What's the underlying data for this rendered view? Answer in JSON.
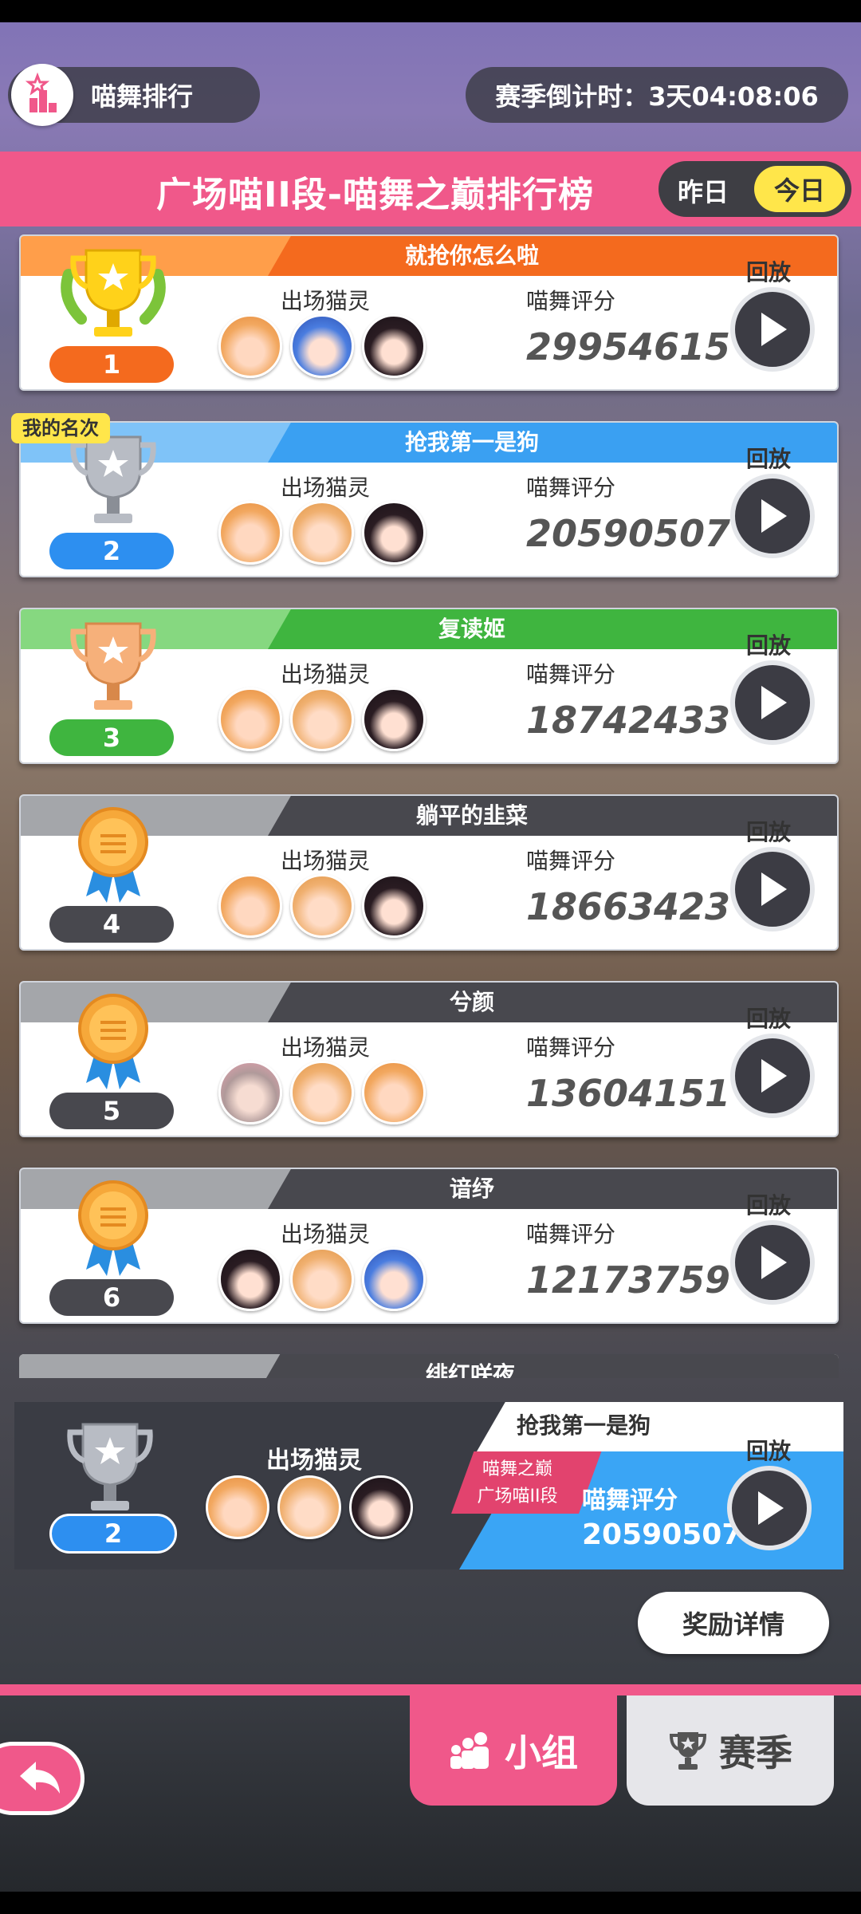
{
  "header": {
    "title": "喵舞排行",
    "countdown": "赛季倒计时：3天04:08:06",
    "board_title": "广场喵II段-喵舞之巅排行榜",
    "toggle": {
      "left": "昨日",
      "right": "今日",
      "selected": "今日"
    }
  },
  "labels": {
    "cats": "出场猫灵",
    "score": "喵舞评分",
    "replay": "回放",
    "my_rank": "我的名次"
  },
  "rows": [
    {
      "rank": "1",
      "name": "就抢你怎么啦",
      "score": "29954615"
    },
    {
      "rank": "2",
      "name": "抢我第一是狗",
      "score": "20590507"
    },
    {
      "rank": "3",
      "name": "复读姬",
      "score": "18742433"
    },
    {
      "rank": "4",
      "name": "躺平的韭菜",
      "score": "18663423"
    },
    {
      "rank": "5",
      "name": "兮颜",
      "score": "13604151"
    },
    {
      "rank": "6",
      "name": "谙纾",
      "score": "12173759"
    }
  ],
  "partial_row": {
    "name": "绯红咲夜"
  },
  "my_entry": {
    "rank": "2",
    "name": "抢我第一是狗",
    "tier_line1": "喵舞之巅",
    "tier_line2": "广场喵II段",
    "score": "20590507"
  },
  "buttons": {
    "reward": "奖励详情"
  },
  "tabs": [
    {
      "label": "小组",
      "icon": "group-icon",
      "active": true
    },
    {
      "label": "赛季",
      "icon": "trophy-icon",
      "active": false
    }
  ],
  "colors": {
    "pink": "#f0588a",
    "yellow": "#ffe64a",
    "gold": "#f47a1a",
    "silver": "#2d8ff0",
    "bronze": "#3fb53f",
    "dark": "#3e3e44"
  }
}
